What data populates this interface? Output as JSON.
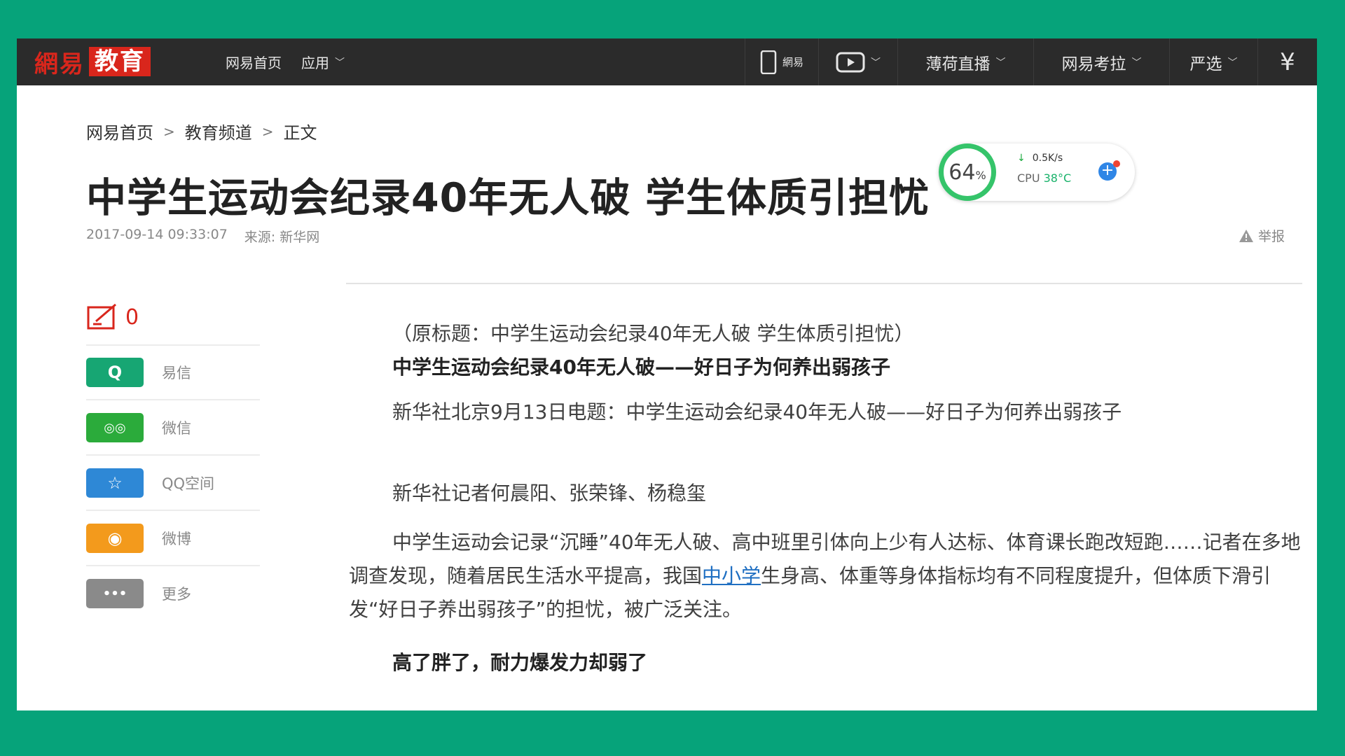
{
  "header": {
    "logo_text": "網易",
    "logo_box": "教育",
    "nav_left": [
      {
        "label": "网易首页"
      },
      {
        "label": "应用"
      }
    ],
    "nav_right": {
      "mobile_label": "網易",
      "live_label": "薄荷直播",
      "exam_label": "网易考拉",
      "yanxuan_label": "严选"
    }
  },
  "breadcrumb": [
    "网易首页",
    "教育频道",
    "正文"
  ],
  "article": {
    "title": "中学生运动会纪录40年无人破 学生体质引担忧",
    "datetime": "2017-09-14 09:33:07",
    "source": "来源: 新华网",
    "report": "举报",
    "original_title": "（原标题：中学生运动会纪录40年无人破 学生体质引担忧）",
    "subtitle": "中学生运动会纪录40年无人破——好日子为何养出弱孩子",
    "para1": "新华社北京9月13日电题：中学生运动会纪录40年无人破——好日子为何养出弱孩子",
    "para2": "新华社记者何晨阳、张荣锋、杨稳玺",
    "para3_before": "中学生运动会记录“沉睡”40年无人破、高中班里引体向上少有人达标、体育课长跑改短跑……记者在多地调查发现，随着居民生活水平提高，我国",
    "para3_link": "中小学",
    "para3_after": "生身高、体重等身体指标均有不同程度提升，但体质下滑引发“好日子养出弱孩子”的担忧，被广泛关注。",
    "section_heading": "高了胖了，耐力爆发力却弱了"
  },
  "sidebar": {
    "comment_count": "0",
    "share": [
      {
        "label": "易信",
        "icon": "yixin-icon",
        "color": "#17a673",
        "glyph": "Q"
      },
      {
        "label": "微信",
        "icon": "wechat-icon",
        "color": "#2bab3b",
        "glyph": "◎◎"
      },
      {
        "label": "QQ空间",
        "icon": "qzone-icon",
        "color": "#2e88d6",
        "glyph": "☆"
      },
      {
        "label": "微博",
        "icon": "weibo-icon",
        "color": "#f39a1c",
        "glyph": "◉"
      },
      {
        "label": "更多",
        "icon": "more-icon",
        "color": "#8a8a8a",
        "glyph": "•••"
      }
    ]
  },
  "monitor": {
    "percent": "64",
    "percent_unit": "%",
    "net_speed": "0.5K/s",
    "cpu_label": "CPU",
    "cpu_temp": "38°C"
  }
}
